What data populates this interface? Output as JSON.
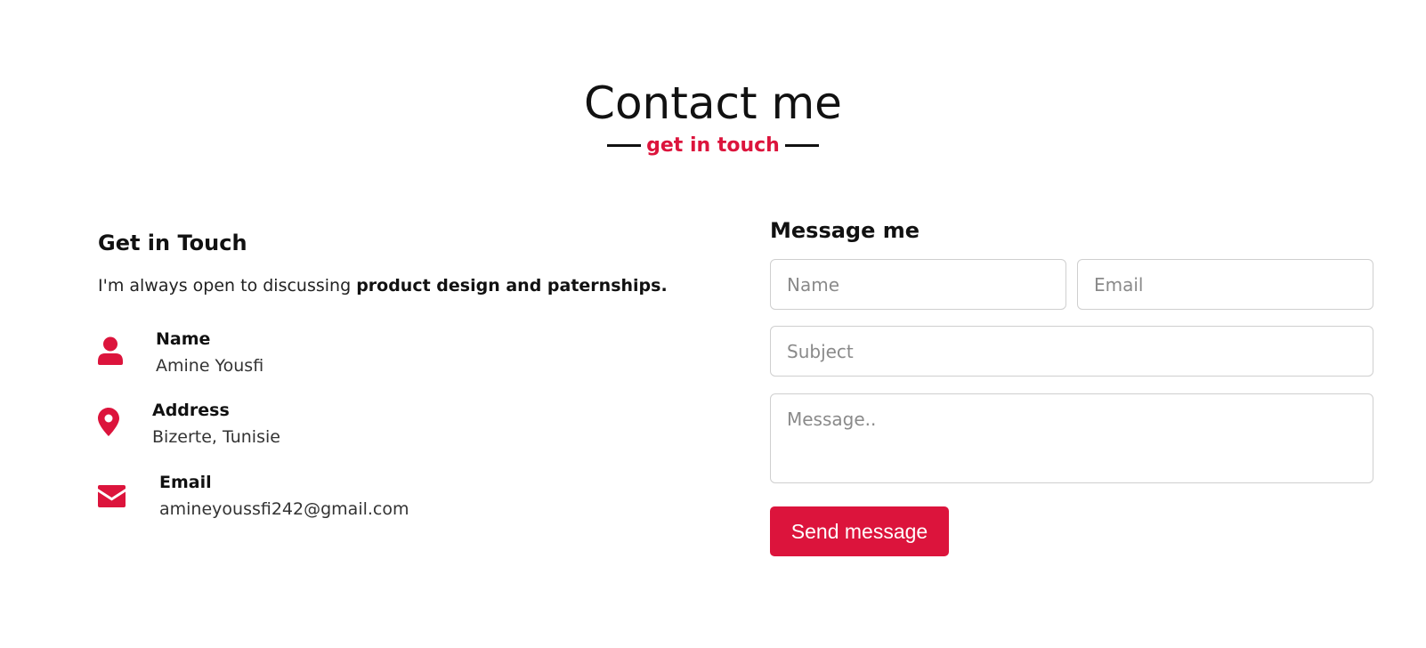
{
  "theme": {
    "accent": "#dc143c",
    "text": "#111111"
  },
  "header": {
    "title": "Contact me",
    "subtitle": "get in touch"
  },
  "contact_info": {
    "heading": "Get in Touch",
    "intro_text": "I'm always open to discussing ",
    "intro_bold": "product design and paternships.",
    "items": [
      {
        "icon": "user-icon",
        "label": "Name",
        "value": "Amine Yousfi"
      },
      {
        "icon": "map-pin-icon",
        "label": "Address",
        "value": "Bizerte, Tunisie"
      },
      {
        "icon": "envelope-icon",
        "label": "Email",
        "value": "amineyoussfi242@gmail.com"
      }
    ]
  },
  "form": {
    "heading": "Message me",
    "name_placeholder": "Name",
    "email_placeholder": "Email",
    "subject_placeholder": "Subject",
    "message_placeholder": "Message..",
    "submit_label": "Send message"
  }
}
